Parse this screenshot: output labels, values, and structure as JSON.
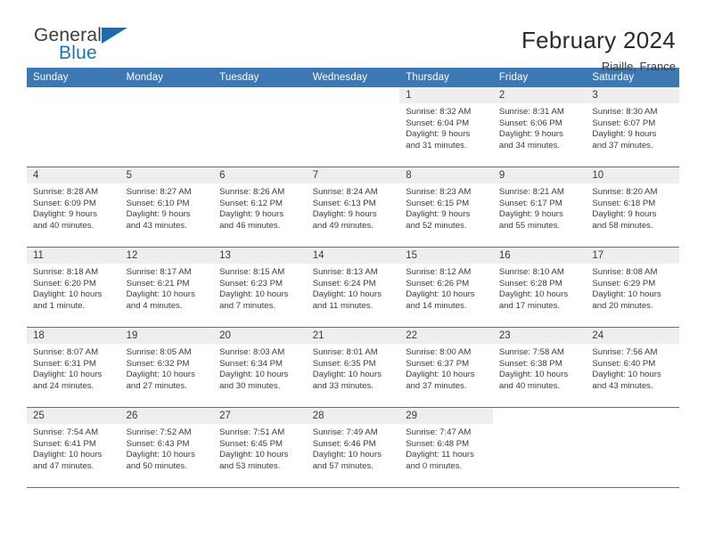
{
  "brand": {
    "word_one": "General",
    "word_two": "Blue",
    "logo_icon": "blue-triangle-icon"
  },
  "header": {
    "title": "February 2024",
    "location": "Riaille, France"
  },
  "colors": {
    "header_blue": "#3c78b4",
    "brand_blue": "#1b74bb",
    "daynum_band": "#eeeeee",
    "row_divider": "#3c78b4",
    "text": "#3b3b3b"
  },
  "labels": {
    "sunrise_prefix": "Sunrise:",
    "sunset_prefix": "Sunset:",
    "daylight_prefix": "Daylight:"
  },
  "weekday_headers": [
    "Sunday",
    "Monday",
    "Tuesday",
    "Wednesday",
    "Thursday",
    "Friday",
    "Saturday"
  ],
  "weeks": [
    [
      {
        "day": "",
        "blank": true
      },
      {
        "day": "",
        "blank": true
      },
      {
        "day": "",
        "blank": true
      },
      {
        "day": "",
        "blank": true
      },
      {
        "day": "1",
        "sunrise": "Sunrise: 8:32 AM",
        "sunset": "Sunset: 6:04 PM",
        "daylight_line1": "Daylight: 9 hours",
        "daylight_line2": "and 31 minutes."
      },
      {
        "day": "2",
        "sunrise": "Sunrise: 8:31 AM",
        "sunset": "Sunset: 6:06 PM",
        "daylight_line1": "Daylight: 9 hours",
        "daylight_line2": "and 34 minutes."
      },
      {
        "day": "3",
        "sunrise": "Sunrise: 8:30 AM",
        "sunset": "Sunset: 6:07 PM",
        "daylight_line1": "Daylight: 9 hours",
        "daylight_line2": "and 37 minutes."
      }
    ],
    [
      {
        "day": "4",
        "sunrise": "Sunrise: 8:28 AM",
        "sunset": "Sunset: 6:09 PM",
        "daylight_line1": "Daylight: 9 hours",
        "daylight_line2": "and 40 minutes."
      },
      {
        "day": "5",
        "sunrise": "Sunrise: 8:27 AM",
        "sunset": "Sunset: 6:10 PM",
        "daylight_line1": "Daylight: 9 hours",
        "daylight_line2": "and 43 minutes."
      },
      {
        "day": "6",
        "sunrise": "Sunrise: 8:26 AM",
        "sunset": "Sunset: 6:12 PM",
        "daylight_line1": "Daylight: 9 hours",
        "daylight_line2": "and 46 minutes."
      },
      {
        "day": "7",
        "sunrise": "Sunrise: 8:24 AM",
        "sunset": "Sunset: 6:13 PM",
        "daylight_line1": "Daylight: 9 hours",
        "daylight_line2": "and 49 minutes."
      },
      {
        "day": "8",
        "sunrise": "Sunrise: 8:23 AM",
        "sunset": "Sunset: 6:15 PM",
        "daylight_line1": "Daylight: 9 hours",
        "daylight_line2": "and 52 minutes."
      },
      {
        "day": "9",
        "sunrise": "Sunrise: 8:21 AM",
        "sunset": "Sunset: 6:17 PM",
        "daylight_line1": "Daylight: 9 hours",
        "daylight_line2": "and 55 minutes."
      },
      {
        "day": "10",
        "sunrise": "Sunrise: 8:20 AM",
        "sunset": "Sunset: 6:18 PM",
        "daylight_line1": "Daylight: 9 hours",
        "daylight_line2": "and 58 minutes."
      }
    ],
    [
      {
        "day": "11",
        "sunrise": "Sunrise: 8:18 AM",
        "sunset": "Sunset: 6:20 PM",
        "daylight_line1": "Daylight: 10 hours",
        "daylight_line2": "and 1 minute."
      },
      {
        "day": "12",
        "sunrise": "Sunrise: 8:17 AM",
        "sunset": "Sunset: 6:21 PM",
        "daylight_line1": "Daylight: 10 hours",
        "daylight_line2": "and 4 minutes."
      },
      {
        "day": "13",
        "sunrise": "Sunrise: 8:15 AM",
        "sunset": "Sunset: 6:23 PM",
        "daylight_line1": "Daylight: 10 hours",
        "daylight_line2": "and 7 minutes."
      },
      {
        "day": "14",
        "sunrise": "Sunrise: 8:13 AM",
        "sunset": "Sunset: 6:24 PM",
        "daylight_line1": "Daylight: 10 hours",
        "daylight_line2": "and 11 minutes."
      },
      {
        "day": "15",
        "sunrise": "Sunrise: 8:12 AM",
        "sunset": "Sunset: 6:26 PM",
        "daylight_line1": "Daylight: 10 hours",
        "daylight_line2": "and 14 minutes."
      },
      {
        "day": "16",
        "sunrise": "Sunrise: 8:10 AM",
        "sunset": "Sunset: 6:28 PM",
        "daylight_line1": "Daylight: 10 hours",
        "daylight_line2": "and 17 minutes."
      },
      {
        "day": "17",
        "sunrise": "Sunrise: 8:08 AM",
        "sunset": "Sunset: 6:29 PM",
        "daylight_line1": "Daylight: 10 hours",
        "daylight_line2": "and 20 minutes."
      }
    ],
    [
      {
        "day": "18",
        "sunrise": "Sunrise: 8:07 AM",
        "sunset": "Sunset: 6:31 PM",
        "daylight_line1": "Daylight: 10 hours",
        "daylight_line2": "and 24 minutes."
      },
      {
        "day": "19",
        "sunrise": "Sunrise: 8:05 AM",
        "sunset": "Sunset: 6:32 PM",
        "daylight_line1": "Daylight: 10 hours",
        "daylight_line2": "and 27 minutes."
      },
      {
        "day": "20",
        "sunrise": "Sunrise: 8:03 AM",
        "sunset": "Sunset: 6:34 PM",
        "daylight_line1": "Daylight: 10 hours",
        "daylight_line2": "and 30 minutes."
      },
      {
        "day": "21",
        "sunrise": "Sunrise: 8:01 AM",
        "sunset": "Sunset: 6:35 PM",
        "daylight_line1": "Daylight: 10 hours",
        "daylight_line2": "and 33 minutes."
      },
      {
        "day": "22",
        "sunrise": "Sunrise: 8:00 AM",
        "sunset": "Sunset: 6:37 PM",
        "daylight_line1": "Daylight: 10 hours",
        "daylight_line2": "and 37 minutes."
      },
      {
        "day": "23",
        "sunrise": "Sunrise: 7:58 AM",
        "sunset": "Sunset: 6:38 PM",
        "daylight_line1": "Daylight: 10 hours",
        "daylight_line2": "and 40 minutes."
      },
      {
        "day": "24",
        "sunrise": "Sunrise: 7:56 AM",
        "sunset": "Sunset: 6:40 PM",
        "daylight_line1": "Daylight: 10 hours",
        "daylight_line2": "and 43 minutes."
      }
    ],
    [
      {
        "day": "25",
        "sunrise": "Sunrise: 7:54 AM",
        "sunset": "Sunset: 6:41 PM",
        "daylight_line1": "Daylight: 10 hours",
        "daylight_line2": "and 47 minutes."
      },
      {
        "day": "26",
        "sunrise": "Sunrise: 7:52 AM",
        "sunset": "Sunset: 6:43 PM",
        "daylight_line1": "Daylight: 10 hours",
        "daylight_line2": "and 50 minutes."
      },
      {
        "day": "27",
        "sunrise": "Sunrise: 7:51 AM",
        "sunset": "Sunset: 6:45 PM",
        "daylight_line1": "Daylight: 10 hours",
        "daylight_line2": "and 53 minutes."
      },
      {
        "day": "28",
        "sunrise": "Sunrise: 7:49 AM",
        "sunset": "Sunset: 6:46 PM",
        "daylight_line1": "Daylight: 10 hours",
        "daylight_line2": "and 57 minutes."
      },
      {
        "day": "29",
        "sunrise": "Sunrise: 7:47 AM",
        "sunset": "Sunset: 6:48 PM",
        "daylight_line1": "Daylight: 11 hours",
        "daylight_line2": "and 0 minutes."
      },
      {
        "day": "",
        "blank": true
      },
      {
        "day": "",
        "blank": true
      }
    ]
  ]
}
